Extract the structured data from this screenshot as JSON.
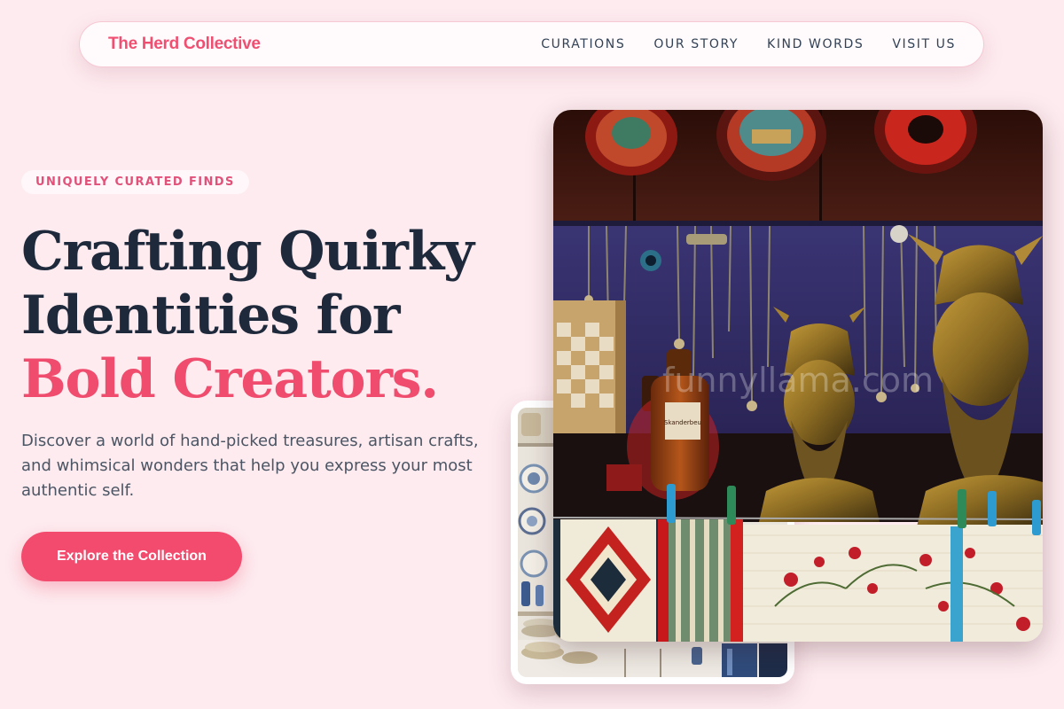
{
  "nav": {
    "brand": "The Herd Collective",
    "links": [
      "CURATIONS",
      "OUR STORY",
      "KIND WORDS",
      "VISIT US"
    ]
  },
  "hero": {
    "badge": "UNIQUELY CURATED FINDS",
    "headline_line1": "Crafting Quirky",
    "headline_line2": "Identities for",
    "headline_accent": "Bold Creators.",
    "description": "Discover a world of hand-picked treasures, artisan crafts, and whimsical wonders that help you express your most authentic self.",
    "cta_label": "Explore the Collection"
  },
  "images": {
    "main_watermark": "funnyllama.com",
    "main_bottle_label": "Skanderbeu"
  },
  "colors": {
    "background": "#fdebef",
    "accent": "#f04d6e",
    "brand": "#ef4f71",
    "heading": "#1e293b",
    "body_text": "#4b5563"
  }
}
